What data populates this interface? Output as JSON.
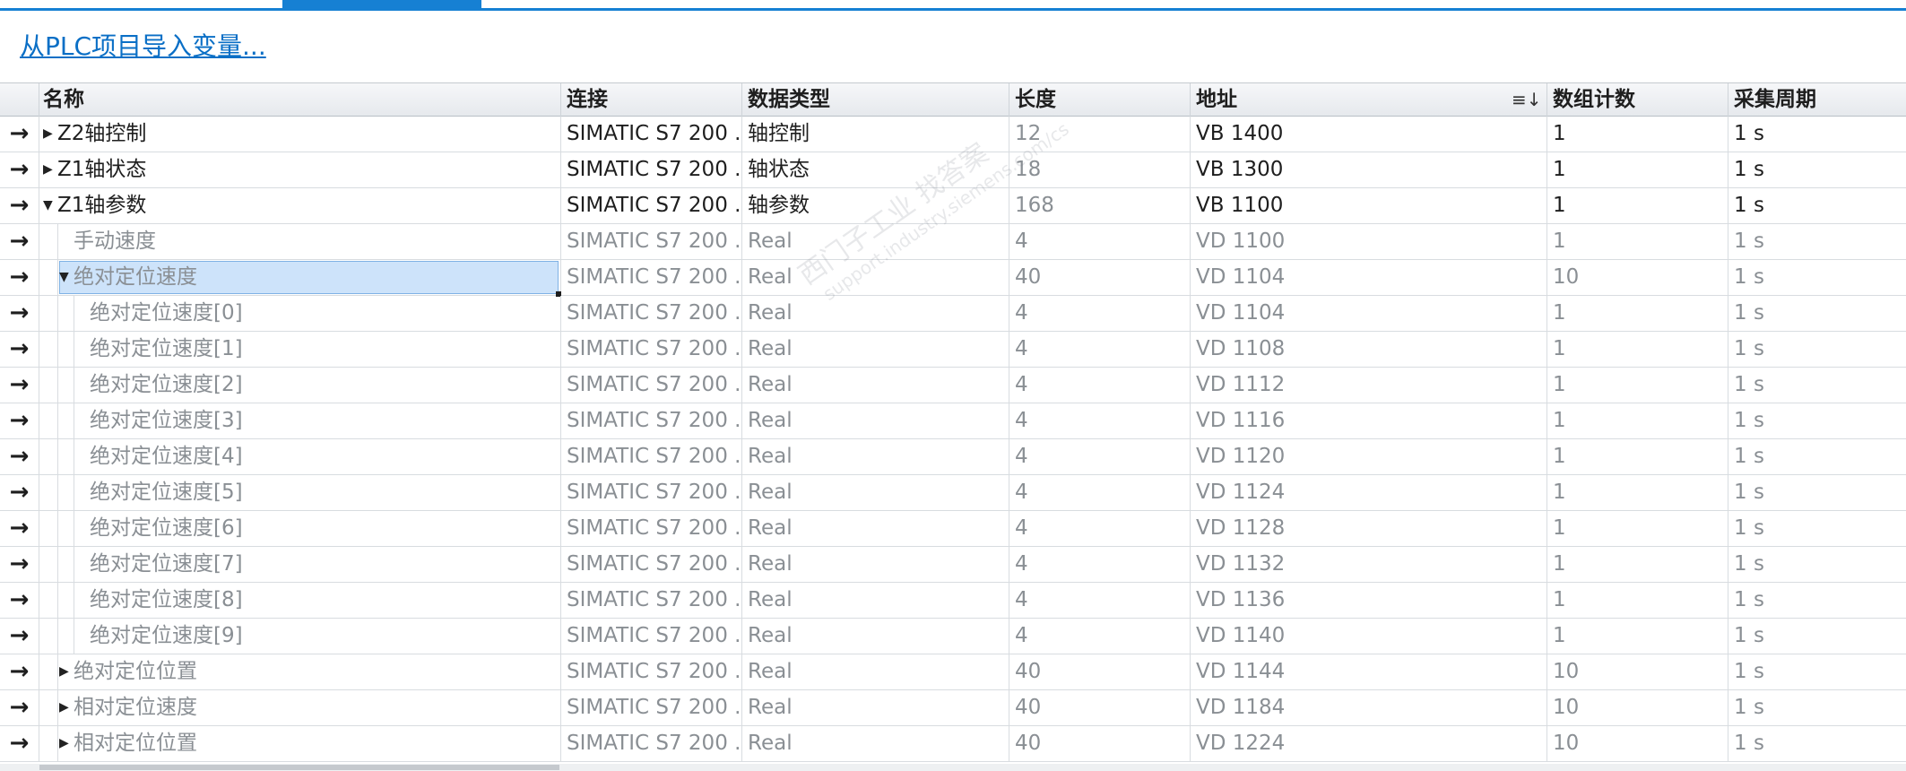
{
  "import_link": "从PLC项目导入变量...",
  "columns": {
    "name": "名称",
    "connection": "连接",
    "datatype": "数据类型",
    "length": "长度",
    "address": "地址",
    "array_count": "数组计数",
    "cycle": "采集周期"
  },
  "sort_icon": "sort-descending-icon",
  "rows": [
    {
      "name": "Z2轴控制",
      "level": 0,
      "toggle": "collapsed",
      "active": true,
      "connection": "SIMATIC S7 200 ...",
      "datatype": "轴控制",
      "length": "12",
      "address": "VB 1400",
      "count": "1",
      "cycle": "1 s"
    },
    {
      "name": "Z1轴状态",
      "level": 0,
      "toggle": "collapsed",
      "active": true,
      "connection": "SIMATIC S7 200 ...",
      "datatype": "轴状态",
      "length": "18",
      "address": "VB 1300",
      "count": "1",
      "cycle": "1 s"
    },
    {
      "name": "Z1轴参数",
      "level": 0,
      "toggle": "expanded",
      "active": true,
      "connection": "SIMATIC S7 200 ...",
      "datatype": "轴参数",
      "length": "168",
      "address": "VB 1100",
      "count": "1",
      "cycle": "1 s"
    },
    {
      "name": "手动速度",
      "level": 1,
      "toggle": "none",
      "active": false,
      "connection": "SIMATIC S7 200 ...",
      "datatype": "Real",
      "length": "4",
      "address": "VD 1100",
      "count": "1",
      "cycle": "1 s"
    },
    {
      "name": "绝对定位速度",
      "level": 1,
      "toggle": "expanded",
      "active": false,
      "selected": true,
      "connection": "SIMATIC S7 200 ...",
      "datatype": "Real",
      "length": "40",
      "address": "VD 1104",
      "count": "10",
      "cycle": "1 s"
    },
    {
      "name": "绝对定位速度[0]",
      "level": 2,
      "toggle": "none",
      "active": false,
      "connection": "SIMATIC S7 200 ...",
      "datatype": "Real",
      "length": "4",
      "address": "VD 1104",
      "count": "1",
      "cycle": "1 s"
    },
    {
      "name": "绝对定位速度[1]",
      "level": 2,
      "toggle": "none",
      "active": false,
      "connection": "SIMATIC S7 200 ...",
      "datatype": "Real",
      "length": "4",
      "address": "VD 1108",
      "count": "1",
      "cycle": "1 s"
    },
    {
      "name": "绝对定位速度[2]",
      "level": 2,
      "toggle": "none",
      "active": false,
      "connection": "SIMATIC S7 200 ...",
      "datatype": "Real",
      "length": "4",
      "address": "VD 1112",
      "count": "1",
      "cycle": "1 s"
    },
    {
      "name": "绝对定位速度[3]",
      "level": 2,
      "toggle": "none",
      "active": false,
      "connection": "SIMATIC S7 200 ...",
      "datatype": "Real",
      "length": "4",
      "address": "VD 1116",
      "count": "1",
      "cycle": "1 s"
    },
    {
      "name": "绝对定位速度[4]",
      "level": 2,
      "toggle": "none",
      "active": false,
      "connection": "SIMATIC S7 200 ...",
      "datatype": "Real",
      "length": "4",
      "address": "VD 1120",
      "count": "1",
      "cycle": "1 s"
    },
    {
      "name": "绝对定位速度[5]",
      "level": 2,
      "toggle": "none",
      "active": false,
      "connection": "SIMATIC S7 200 ...",
      "datatype": "Real",
      "length": "4",
      "address": "VD 1124",
      "count": "1",
      "cycle": "1 s"
    },
    {
      "name": "绝对定位速度[6]",
      "level": 2,
      "toggle": "none",
      "active": false,
      "connection": "SIMATIC S7 200 ...",
      "datatype": "Real",
      "length": "4",
      "address": "VD 1128",
      "count": "1",
      "cycle": "1 s"
    },
    {
      "name": "绝对定位速度[7]",
      "level": 2,
      "toggle": "none",
      "active": false,
      "connection": "SIMATIC S7 200 ...",
      "datatype": "Real",
      "length": "4",
      "address": "VD 1132",
      "count": "1",
      "cycle": "1 s"
    },
    {
      "name": "绝对定位速度[8]",
      "level": 2,
      "toggle": "none",
      "active": false,
      "connection": "SIMATIC S7 200 ...",
      "datatype": "Real",
      "length": "4",
      "address": "VD 1136",
      "count": "1",
      "cycle": "1 s"
    },
    {
      "name": "绝对定位速度[9]",
      "level": 2,
      "toggle": "none",
      "active": false,
      "connection": "SIMATIC S7 200 ...",
      "datatype": "Real",
      "length": "4",
      "address": "VD 1140",
      "count": "1",
      "cycle": "1 s"
    },
    {
      "name": "绝对定位位置",
      "level": 1,
      "toggle": "collapsed",
      "active": false,
      "connection": "SIMATIC S7 200 ...",
      "datatype": "Real",
      "length": "40",
      "address": "VD 1144",
      "count": "10",
      "cycle": "1 s"
    },
    {
      "name": "相对定位速度",
      "level": 1,
      "toggle": "collapsed",
      "active": false,
      "connection": "SIMATIC S7 200 ...",
      "datatype": "Real",
      "length": "40",
      "address": "VD 1184",
      "count": "10",
      "cycle": "1 s"
    },
    {
      "name": "相对定位位置",
      "level": 1,
      "toggle": "collapsed",
      "active": false,
      "connection": "SIMATIC S7 200 ...",
      "datatype": "Real",
      "length": "40",
      "address": "VD 1224",
      "count": "10",
      "cycle": "1 s"
    }
  ],
  "watermark": {
    "line1": "西门子工业 找答案",
    "line2": "support.industry.siemens.com/cs"
  },
  "colors": {
    "accent": "#1680d3",
    "link": "#0a6fc6",
    "selection": "#cde3fa",
    "dim_text": "#8a8f94"
  }
}
